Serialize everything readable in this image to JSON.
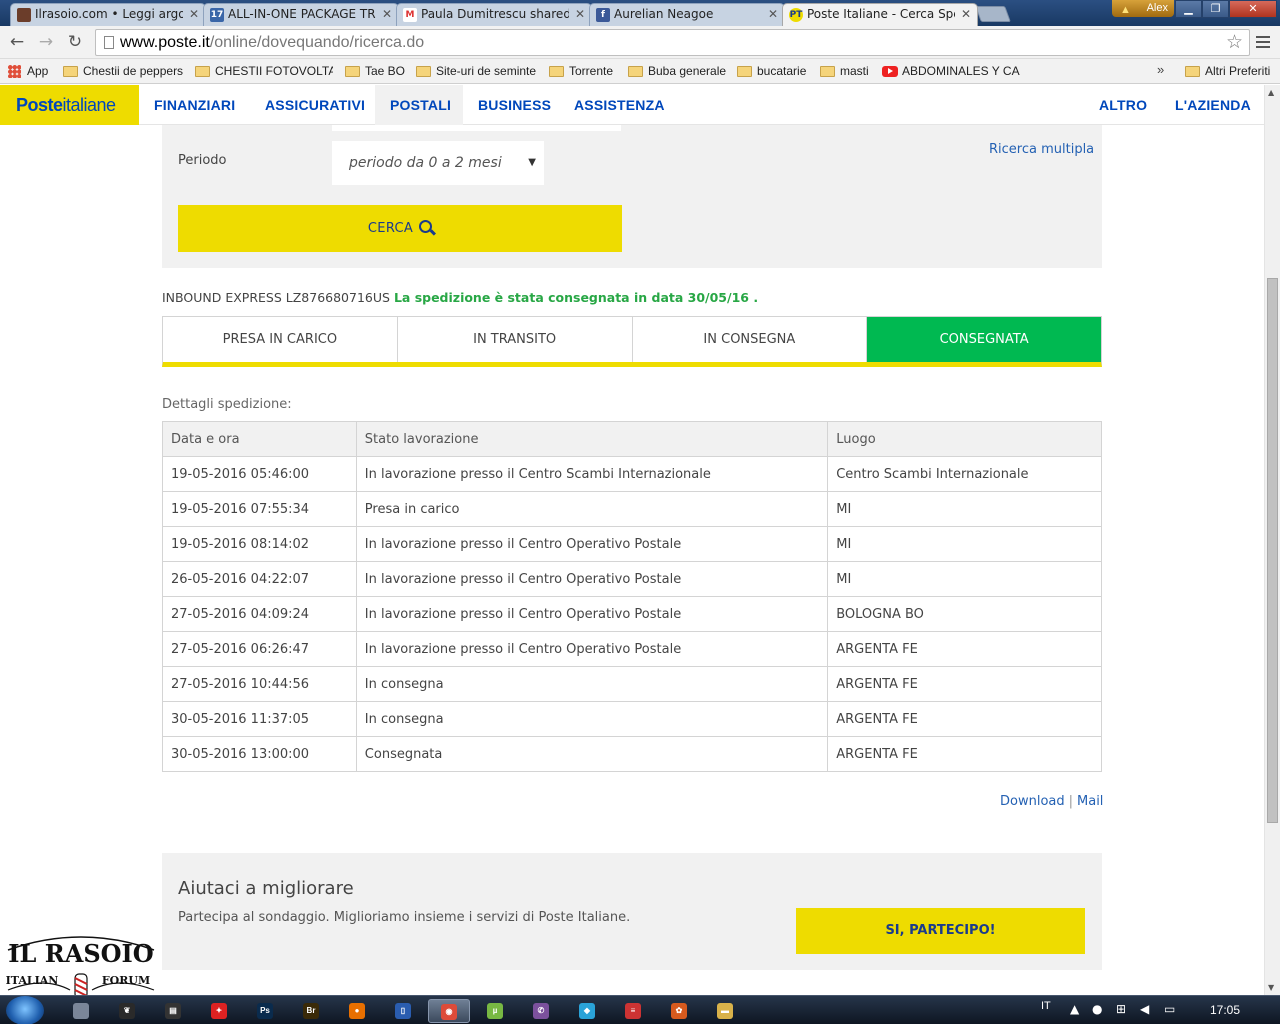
{
  "browser": {
    "tabs": [
      {
        "title": "Ilrasoio.com • Leggi argom",
        "favicon": "forum-icon",
        "fav_color": "#6b3d2a",
        "fav_text": ""
      },
      {
        "title": "ALL-IN-ONE PACKAGE TR",
        "favicon": "calendar-17-icon",
        "fav_color": "#3a66a8",
        "fav_text": "17"
      },
      {
        "title": "Paula Dumitrescu shared",
        "favicon": "gmail-icon",
        "fav_color": "#ffffff",
        "fav_text": "M"
      },
      {
        "title": "Aurelian Neagoe",
        "favicon": "facebook-icon",
        "fav_color": "#3b5998",
        "fav_text": "f"
      },
      {
        "title": "Poste Italiane - Cerca Spe",
        "favicon": "poste-icon",
        "fav_color": "#eedc00",
        "fav_text": "PT"
      }
    ],
    "user_name": "Alex",
    "url_host": "www.poste.it",
    "url_path": "/online/dovequando/ricerca.do",
    "bookmarks": [
      {
        "label": "App",
        "icon": "apps-grid-icon"
      },
      {
        "label": "Chestii de peppers",
        "icon": "folder-icon"
      },
      {
        "label": "CHESTII FOTOVOLTAI",
        "icon": "folder-icon"
      },
      {
        "label": "Tae BO",
        "icon": "folder-icon"
      },
      {
        "label": "Site-uri de seminte",
        "icon": "folder-icon"
      },
      {
        "label": "Torrente",
        "icon": "folder-icon"
      },
      {
        "label": "Buba generale",
        "icon": "folder-icon"
      },
      {
        "label": "bucatarie",
        "icon": "folder-icon"
      },
      {
        "label": "masti",
        "icon": "folder-icon"
      },
      {
        "label": "ABDOMINALES Y CAR",
        "icon": "youtube-icon"
      }
    ],
    "bookmarks_more": "»",
    "other_bookmarks": "Altri Preferiti"
  },
  "site": {
    "logo_bold": "Poste",
    "logo_light": "italiane",
    "nav": [
      "FINANZIARI",
      "ASSICURATIVI",
      "POSTALI",
      "BUSINESS",
      "ASSISTENZA"
    ],
    "nav_right": [
      "ALTRO",
      "L'AZIENDA"
    ],
    "active_nav": "POSTALI"
  },
  "search": {
    "period_label": "Periodo",
    "period_value": "periodo da 0 a 2 mesi",
    "multi_search_link": "Ricerca multipla",
    "search_button": "CERCA"
  },
  "shipment": {
    "code_text": "INBOUND EXPRESS LZ876680716US",
    "status_text": "La spedizione è stata consegnata in data 30/05/16 ."
  },
  "steps": [
    {
      "label": "PRESA IN CARICO",
      "done": false
    },
    {
      "label": "IN TRANSITO",
      "done": false
    },
    {
      "label": "IN CONSEGNA",
      "done": false
    },
    {
      "label": "CONSEGNATA",
      "done": true
    }
  ],
  "details": {
    "title": "Dettagli spedizione:",
    "headers": [
      "Data e ora",
      "Stato lavorazione",
      "Luogo"
    ],
    "rows": [
      [
        "19-05-2016 05:46:00",
        "In lavorazione presso il Centro Scambi Internazionale",
        "Centro Scambi Internazionale"
      ],
      [
        "19-05-2016 07:55:34",
        "Presa in carico",
        "MI"
      ],
      [
        "19-05-2016 08:14:02",
        "In lavorazione presso il Centro Operativo Postale",
        "MI"
      ],
      [
        "26-05-2016 04:22:07",
        "In lavorazione presso il Centro Operativo Postale",
        "MI"
      ],
      [
        "27-05-2016 04:09:24",
        "In lavorazione presso il Centro Operativo Postale",
        "BOLOGNA BO"
      ],
      [
        "27-05-2016 06:26:47",
        "In lavorazione presso il Centro Operativo Postale",
        "ARGENTA FE"
      ],
      [
        "27-05-2016 10:44:56",
        "In consegna",
        "ARGENTA FE"
      ],
      [
        "30-05-2016 11:37:05",
        "In consegna",
        "ARGENTA FE"
      ],
      [
        "30-05-2016 13:00:00",
        "Consegnata",
        "ARGENTA FE"
      ]
    ]
  },
  "actions": {
    "download": "Download",
    "separator": "|",
    "mail": "Mail"
  },
  "survey": {
    "title": "Aiutaci a migliorare",
    "text": "Partecipa al sondaggio. Miglioriamo insieme i servizi di Poste Italiane.",
    "button": "SI, PARTECIPO!"
  },
  "watermark": {
    "line1": "IL RASOIO",
    "line2_left": "ITALIAN",
    "line2_right": "FORUM"
  },
  "taskbar": {
    "language": "IT",
    "time": "17:05",
    "apps": [
      {
        "icon": "explorer-tower-icon",
        "color": "#7a8699",
        "text": ""
      },
      {
        "icon": "wolf-icon",
        "color": "#2a2a2a",
        "text": "❦"
      },
      {
        "icon": "clapper-icon",
        "color": "#333",
        "text": "▤"
      },
      {
        "icon": "maple-leaf-icon",
        "color": "#d22",
        "text": "✦"
      },
      {
        "icon": "photoshop-icon",
        "color": "#0a2b4d",
        "text": "Ps"
      },
      {
        "icon": "bridge-icon",
        "color": "#3a2a08",
        "text": "Br"
      },
      {
        "icon": "firefox-icon",
        "color": "#e76f00",
        "text": "●"
      },
      {
        "icon": "notepad-icon",
        "color": "#2a5db0",
        "text": "▯"
      },
      {
        "icon": "chrome-icon",
        "color": "#dd4b39",
        "text": "◉"
      },
      {
        "icon": "utorrent-icon",
        "color": "#78b843",
        "text": "µ"
      },
      {
        "icon": "viber-icon",
        "color": "#7b519d",
        "text": "✆"
      },
      {
        "icon": "kodi-icon",
        "color": "#2aa3d8",
        "text": "◆"
      },
      {
        "icon": "flag-icon",
        "color": "#c33",
        "text": "≡"
      },
      {
        "icon": "paw-icon",
        "color": "#d65a1e",
        "text": "✿"
      },
      {
        "icon": "folder-icon",
        "color": "#d9b24a",
        "text": "▬"
      }
    ]
  }
}
